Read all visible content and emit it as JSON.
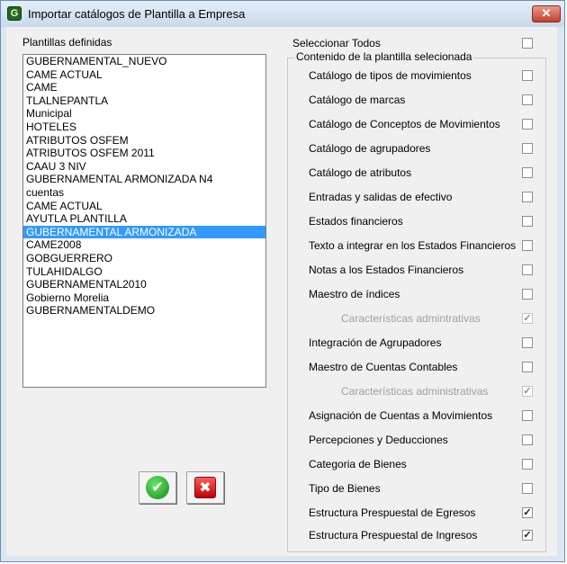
{
  "window": {
    "title": "Importar catálogos de Plantilla a Empresa",
    "close_glyph": "✕"
  },
  "templates": {
    "label": "Plantillas definidas",
    "items": [
      "GUBERNAMENTAL_NUEVO",
      "CAME ACTUAL",
      "CAME",
      "TLALNEPANTLA",
      "Municipal",
      "HOTELES",
      "ATRIBUTOS OSFEM",
      "ATRIBUTOS OSFEM 2011",
      "CAAU 3 NIV",
      "GUBERNAMENTAL ARMONIZADA N4",
      "cuentas",
      "CAME ACTUAL",
      "AYUTLA PLANTILLA",
      "GUBERNAMENTAL ARMONIZADA",
      "CAME2008",
      "GOBGUERRERO",
      "TULAHIDALGO",
      "GUBERNAMENTAL2010",
      "Gobierno Morelia",
      "GUBERNAMENTALDEMO"
    ],
    "selected": "GUBERNAMENTAL ARMONIZADA"
  },
  "select_all": {
    "label": "Seleccionar Todos",
    "checked": false
  },
  "content_group": {
    "title": "Contenido de la plantilla selecionada",
    "options": [
      {
        "label": "Catálogo de tipos de movimientos",
        "checked": false,
        "enabled": true
      },
      {
        "label": "Catálogo de marcas",
        "checked": false,
        "enabled": true
      },
      {
        "label": "Catálogo de Conceptos de Movimientos",
        "checked": false,
        "enabled": true
      },
      {
        "label": "Catálogo de agrupadores",
        "checked": false,
        "enabled": true
      },
      {
        "label": "Catálogo de atributos",
        "checked": false,
        "enabled": true
      },
      {
        "label": "Entradas y salidas de efectivo",
        "checked": false,
        "enabled": true
      },
      {
        "label": "Estados financieros",
        "checked": false,
        "enabled": true
      },
      {
        "label": "Texto a integrar en los Estados Financieros",
        "checked": false,
        "enabled": true
      },
      {
        "label": "Notas a los Estados Financieros",
        "checked": false,
        "enabled": true
      },
      {
        "label": "Maestro de índices",
        "checked": false,
        "enabled": true
      },
      {
        "label": "Características admintrativas",
        "checked": true,
        "enabled": false,
        "indent": true
      },
      {
        "label": "Integración de Agrupadores",
        "checked": false,
        "enabled": true
      },
      {
        "label": "Maestro de Cuentas Contables",
        "checked": false,
        "enabled": true
      },
      {
        "label": "Características administrativas",
        "checked": true,
        "enabled": false,
        "indent": true
      },
      {
        "label": "Asignación de Cuentas a Movimientos",
        "checked": false,
        "enabled": true
      },
      {
        "label": "Percepciones y Deducciones",
        "checked": false,
        "enabled": true
      },
      {
        "label": "Categoria de Bienes",
        "checked": false,
        "enabled": true
      },
      {
        "label": "Tipo de Bienes",
        "checked": false,
        "enabled": true
      },
      {
        "label": "Estructura Prespuestal de Egresos",
        "checked": true,
        "enabled": true
      },
      {
        "label": "Estructura Prespuestal de Ingresos",
        "checked": true,
        "enabled": true
      }
    ]
  },
  "buttons": {
    "ok_glyph": "✔",
    "cancel_glyph": "✖"
  },
  "check_glyph": "✓"
}
